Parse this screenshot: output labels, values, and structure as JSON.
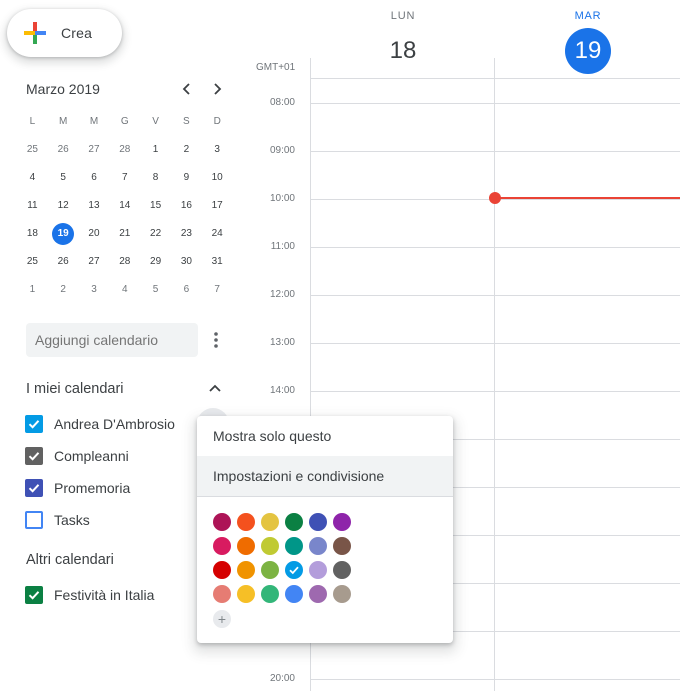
{
  "create": {
    "label": "Crea"
  },
  "mini_calendar": {
    "title": "Marzo 2019",
    "weekdays": [
      "L",
      "M",
      "M",
      "G",
      "V",
      "S",
      "D"
    ],
    "weeks": [
      [
        {
          "d": "25",
          "m": true
        },
        {
          "d": "26",
          "m": true
        },
        {
          "d": "27",
          "m": true
        },
        {
          "d": "28",
          "m": true
        },
        {
          "d": "1"
        },
        {
          "d": "2"
        },
        {
          "d": "3"
        }
      ],
      [
        {
          "d": "4"
        },
        {
          "d": "5"
        },
        {
          "d": "6"
        },
        {
          "d": "7"
        },
        {
          "d": "8"
        },
        {
          "d": "9"
        },
        {
          "d": "10"
        }
      ],
      [
        {
          "d": "11"
        },
        {
          "d": "12"
        },
        {
          "d": "13"
        },
        {
          "d": "14"
        },
        {
          "d": "15"
        },
        {
          "d": "16"
        },
        {
          "d": "17"
        }
      ],
      [
        {
          "d": "18"
        },
        {
          "d": "19",
          "today": true
        },
        {
          "d": "20"
        },
        {
          "d": "21"
        },
        {
          "d": "22"
        },
        {
          "d": "23"
        },
        {
          "d": "24"
        }
      ],
      [
        {
          "d": "25"
        },
        {
          "d": "26"
        },
        {
          "d": "27"
        },
        {
          "d": "28"
        },
        {
          "d": "29"
        },
        {
          "d": "30"
        },
        {
          "d": "31"
        }
      ],
      [
        {
          "d": "1",
          "m": true
        },
        {
          "d": "2",
          "m": true
        },
        {
          "d": "3",
          "m": true
        },
        {
          "d": "4",
          "m": true
        },
        {
          "d": "5",
          "m": true
        },
        {
          "d": "6",
          "m": true
        },
        {
          "d": "7",
          "m": true
        }
      ]
    ]
  },
  "add_calendar": {
    "placeholder": "Aggiungi calendario"
  },
  "my_calendars": {
    "title": "I miei calendari",
    "items": [
      {
        "name": "Andrea D'Ambrosio",
        "color": "#039be5",
        "checked": true
      },
      {
        "name": "Compleanni",
        "color": "#616161",
        "checked": true
      },
      {
        "name": "Promemoria",
        "color": "#3f51b5",
        "checked": true
      },
      {
        "name": "Tasks",
        "color": "#4285f4",
        "checked": false
      }
    ]
  },
  "other_calendars": {
    "title": "Altri calendari",
    "items": [
      {
        "name": "Festività in Italia",
        "color": "#0b8043",
        "checked": true
      }
    ]
  },
  "days": [
    {
      "name": "LUN",
      "num": "18",
      "active": false
    },
    {
      "name": "MAR",
      "num": "19",
      "active": true
    }
  ],
  "timezone": "GMT+01",
  "hours": [
    "08:00",
    "09:00",
    "10:00",
    "11:00",
    "12:00",
    "13:00",
    "14:00",
    "20:00"
  ],
  "menu": {
    "show_only": "Mostra solo questo",
    "settings": "Impostazioni e condivisione",
    "colors": [
      [
        "#ad1457",
        "#f4511e",
        "#e4c441",
        "#0b8043",
        "#3f51b5",
        "#8e24aa"
      ],
      [
        "#d81b60",
        "#ef6c00",
        "#c0ca33",
        "#009688",
        "#7986cb",
        "#795548"
      ],
      [
        "#d50000",
        "#f09300",
        "#7cb342",
        "#039be5",
        "#b39ddb",
        "#616161"
      ],
      [
        "#e67c73",
        "#f6bf26",
        "#33b679",
        "#4285f4",
        "#9e69af",
        "#a79b8e"
      ]
    ],
    "selected_color": "#039be5",
    "add_icon": "+"
  }
}
